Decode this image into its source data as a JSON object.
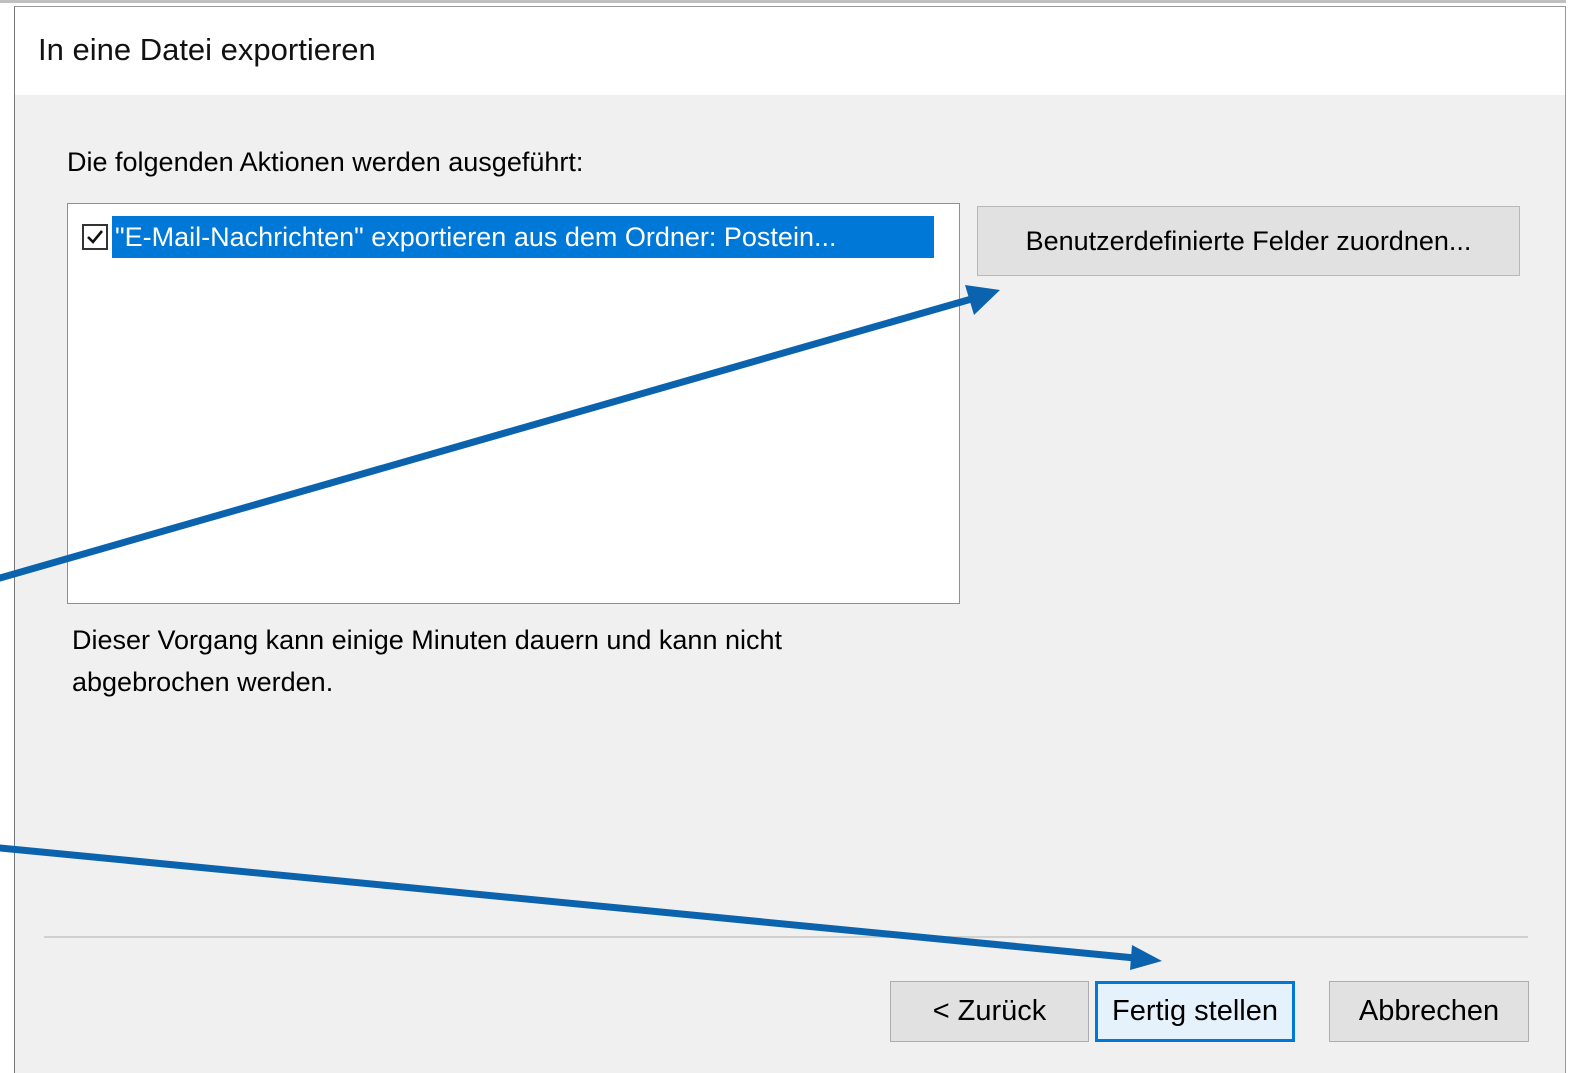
{
  "dialog": {
    "title": "In eine Datei exportieren",
    "section_label": "Die folgenden Aktionen werden ausgeführt:",
    "actions": [
      {
        "checked": true,
        "label": "\"E-Mail-Nachrichten\" exportieren aus dem Ordner: Postein..."
      }
    ],
    "map_fields_button": "Benutzerdefinierte Felder zuordnen...",
    "note_line1": "Dieser Vorgang kann einige Minuten dauern und kann nicht",
    "note_line2": "abgebrochen werden.",
    "buttons": {
      "back": "< Zurück",
      "finish": "Fertig stellen",
      "cancel": "Abbrechen"
    }
  },
  "colors": {
    "accent": "#0078d7",
    "annotation_arrow": "#0b63ad",
    "dialog_bg": "#f0f0f0"
  },
  "annotations": {
    "arrow_count": 2,
    "arrow_1_target": "map_fields_button",
    "arrow_2_target": "finish_button"
  }
}
